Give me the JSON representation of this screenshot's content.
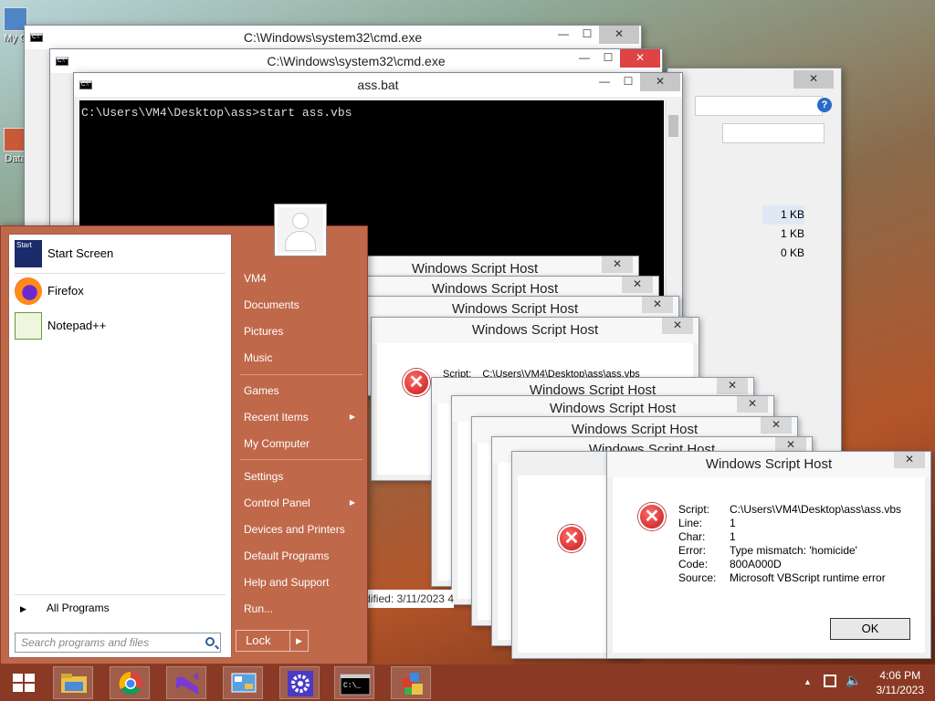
{
  "desktop": {
    "icons": [
      {
        "label": "My C"
      },
      {
        "label": "Data"
      }
    ]
  },
  "windows": {
    "cmd1": {
      "title": "C:\\Windows\\system32\\cmd.exe"
    },
    "cmd2": {
      "title": "C:\\Windows\\system32\\cmd.exe"
    },
    "assbat": {
      "title": "ass.bat",
      "console_text": "C:\\Users\\VM4\\Desktop\\ass>start ass.vbs"
    },
    "explorer": {
      "sizes": [
        "1 KB",
        "1 KB",
        "0 KB"
      ],
      "status_text": "Date modified: 3/11/2023 4:"
    }
  },
  "wsh": {
    "title": "Windows Script Host",
    "script_path_partial": "C:\\Users\\VM4\\Desktop\\ass\\ass.vbs",
    "details": [
      {
        "key": "Script:",
        "value": "C:\\Users\\VM4\\Desktop\\ass\\ass.vbs"
      },
      {
        "key": "Line:",
        "value": "1"
      },
      {
        "key": "Char:",
        "value": "1"
      },
      {
        "key": "Error:",
        "value": "Type mismatch: 'homicide'"
      },
      {
        "key": "Code:",
        "value": "800A000D"
      },
      {
        "key": "Source:",
        "value": "Microsoft VBScript runtime error"
      }
    ],
    "ok_label": "OK"
  },
  "start_menu": {
    "programs": [
      {
        "label": "Start Screen",
        "icon": "start-screen-icon"
      },
      {
        "label": "Firefox",
        "icon": "firefox-icon"
      },
      {
        "label": "Notepad++",
        "icon": "notepadpp-icon"
      }
    ],
    "start_icon_text": "Start",
    "all_programs": "All Programs",
    "search_placeholder": "Search programs and files",
    "right_items": [
      "VM4",
      "Documents",
      "Pictures",
      "Music",
      "Games",
      "Recent Items",
      "My Computer",
      "Settings",
      "Control Panel",
      "Devices and Printers",
      "Default Programs",
      "Help and Support",
      "Run..."
    ],
    "lock_label": "Lock"
  },
  "taskbar": {
    "apps": [
      "windows-start-icon",
      "file-explorer-icon",
      "chrome-icon",
      "visual-studio-icon",
      "control-panel-icon",
      "settings-gear-icon",
      "cmd-icon",
      "installer-icon"
    ],
    "time": "4:06 PM",
    "date": "3/11/2023"
  },
  "colors": {
    "start_menu": "#c0684a",
    "taskbar": "#8a3a24",
    "error_red": "#c41a1a"
  }
}
